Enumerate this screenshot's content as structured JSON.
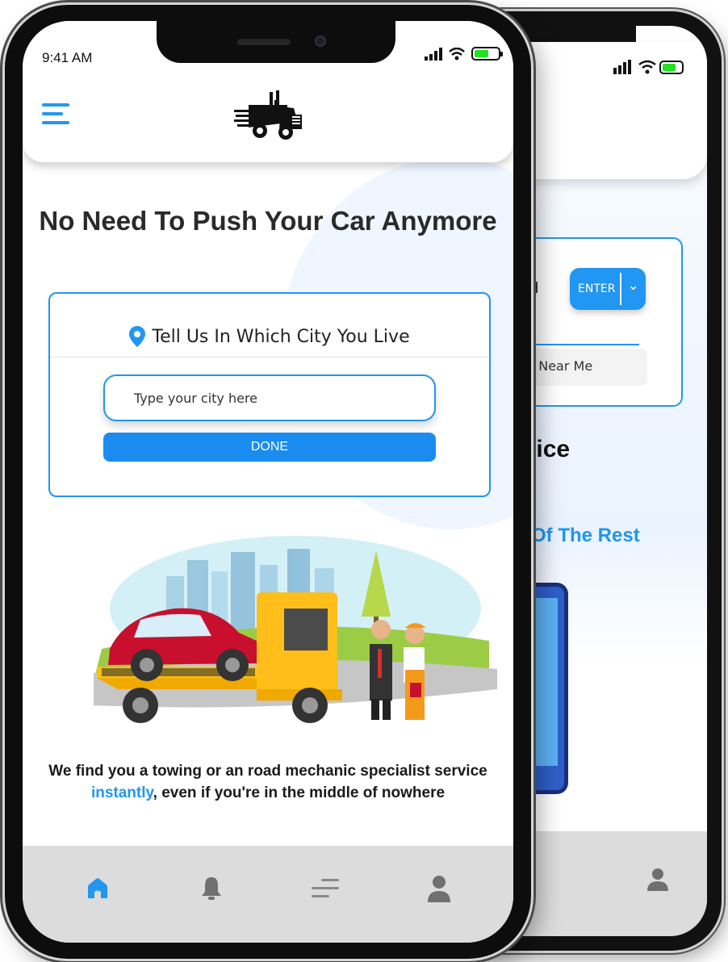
{
  "back_phone": {
    "input_fragment": "eded",
    "enter_label": "ENTER",
    "suggestion_fragment": "Road Near Me",
    "heading_fragment": "rvice",
    "subheading_fragment": "e Of The Rest"
  },
  "status_bar": {
    "time": "9:41 AM"
  },
  "header": {
    "logo": "tow-truck-logo",
    "menu_icon": "hamburger-menu-icon"
  },
  "hero": {
    "headline": "No Need To Push Your Car Anymore"
  },
  "city_card": {
    "title": "Tell Us In Which City You Live",
    "input_placeholder": "Type your city here",
    "input_value": "",
    "done_label": "DONE"
  },
  "tagline": {
    "before": "We find you a towing or an road mechanic specialist service ",
    "highlight": "instantly",
    "after": ", even if you're in the middle of nowhere"
  },
  "bottom_nav": {
    "items": [
      {
        "icon": "home-icon",
        "active": true
      },
      {
        "icon": "bell-icon",
        "active": false
      },
      {
        "icon": "menu-lines-icon",
        "active": false
      },
      {
        "icon": "user-icon",
        "active": false
      }
    ]
  },
  "colors": {
    "accent": "#2196f3",
    "nav_background": "#dcdcdc",
    "inactive_icon": "#707070"
  }
}
